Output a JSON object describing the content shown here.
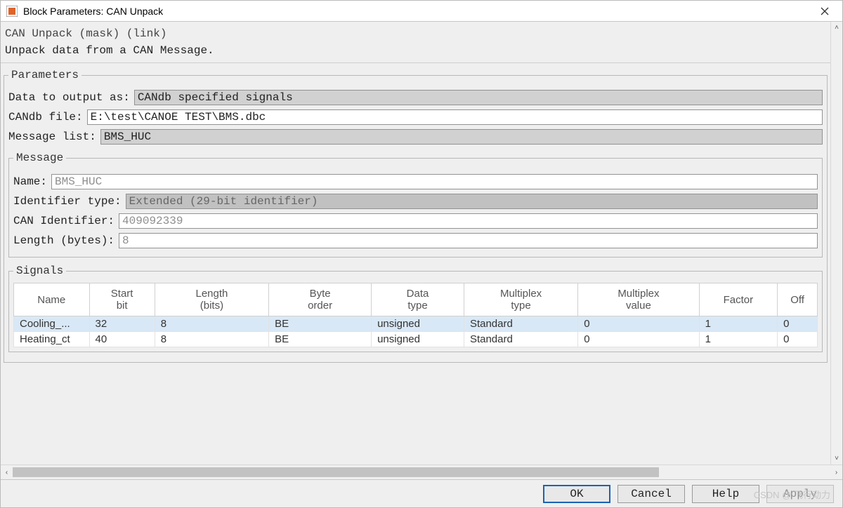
{
  "window": {
    "title": "Block Parameters: CAN Unpack"
  },
  "header": {
    "mask_line": "CAN Unpack (mask) (link)",
    "description": "Unpack data from a CAN Message."
  },
  "parameters": {
    "legend": "Parameters",
    "data_output_label": "Data to output as:",
    "data_output_value": "CANdb specified signals",
    "candb_file_label": "CANdb file:",
    "candb_file_value": "E:\\test\\CANOE TEST\\BMS.dbc",
    "message_list_label": "Message list:",
    "message_list_value": "BMS_HUC"
  },
  "message": {
    "legend": "Message",
    "name_label": "Name:",
    "name_value": "BMS_HUC",
    "id_type_label": "Identifier type:",
    "id_type_value": "Extended (29-bit identifier)",
    "can_id_label": "CAN Identifier:",
    "can_id_value": "409092339",
    "length_label": "Length (bytes):",
    "length_value": "8"
  },
  "signals": {
    "legend": "Signals",
    "columns": [
      "Name",
      "Start bit",
      "Length (bits)",
      "Byte order",
      "Data type",
      "Multiplex type",
      "Multiplex value",
      "Factor",
      "Off"
    ],
    "rows": [
      {
        "name": "Cooling_...",
        "start_bit": "32",
        "length": "8",
        "byte_order": "BE",
        "data_type": "unsigned",
        "mux_type": "Standard",
        "mux_value": "0",
        "factor": "1",
        "off": "0"
      },
      {
        "name": "Heating_ct",
        "start_bit": "40",
        "length": "8",
        "byte_order": "BE",
        "data_type": "unsigned",
        "mux_type": "Standard",
        "mux_value": "0",
        "factor": "1",
        "off": "0"
      }
    ],
    "selected_index": 0
  },
  "footer": {
    "ok": "OK",
    "cancel": "Cancel",
    "help": "Help",
    "apply": "Apply"
  },
  "watermark": "CSDN @ 飞行动力"
}
